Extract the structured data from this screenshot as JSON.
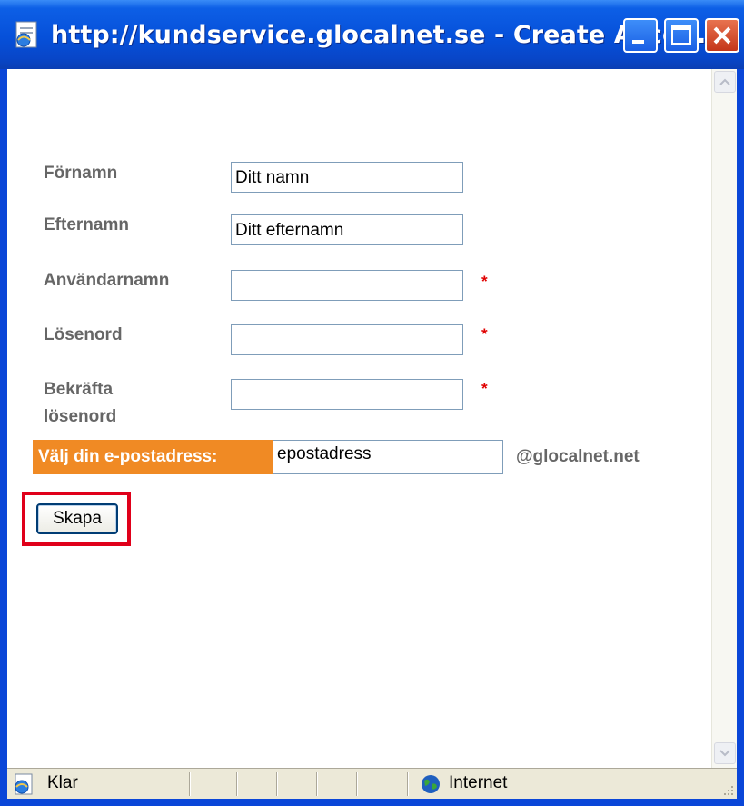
{
  "window": {
    "title": "http://kundservice.glocalnet.se - Create Accou...",
    "minimize_icon": "minimize-icon",
    "maximize_icon": "maximize-icon",
    "close_icon": "close-icon"
  },
  "form": {
    "fields": [
      {
        "label": "Förnamn",
        "value": "Ditt namn",
        "required": false
      },
      {
        "label": "Efternamn",
        "value": "Ditt efternamn",
        "required": false
      },
      {
        "label": "Användarnamn",
        "value": "",
        "required": true
      },
      {
        "label": "Lösenord",
        "value": "",
        "required": true
      },
      {
        "label_line1": "Bekräfta",
        "label_line2": "lösenord",
        "value": "",
        "required": true
      }
    ],
    "required_marker": "*",
    "email": {
      "label": "Välj din e-postadress:",
      "value": "epostadress",
      "domain": "@glocalnet.net"
    },
    "submit_label": "Skapa"
  },
  "statusbar": {
    "status": "Klar",
    "zone": "Internet"
  },
  "colors": {
    "titlebar": "#0650d9",
    "accent_orange": "#f08a24",
    "required_red": "#e00000",
    "highlight_red": "#e0001a",
    "label_gray": "#666666"
  }
}
